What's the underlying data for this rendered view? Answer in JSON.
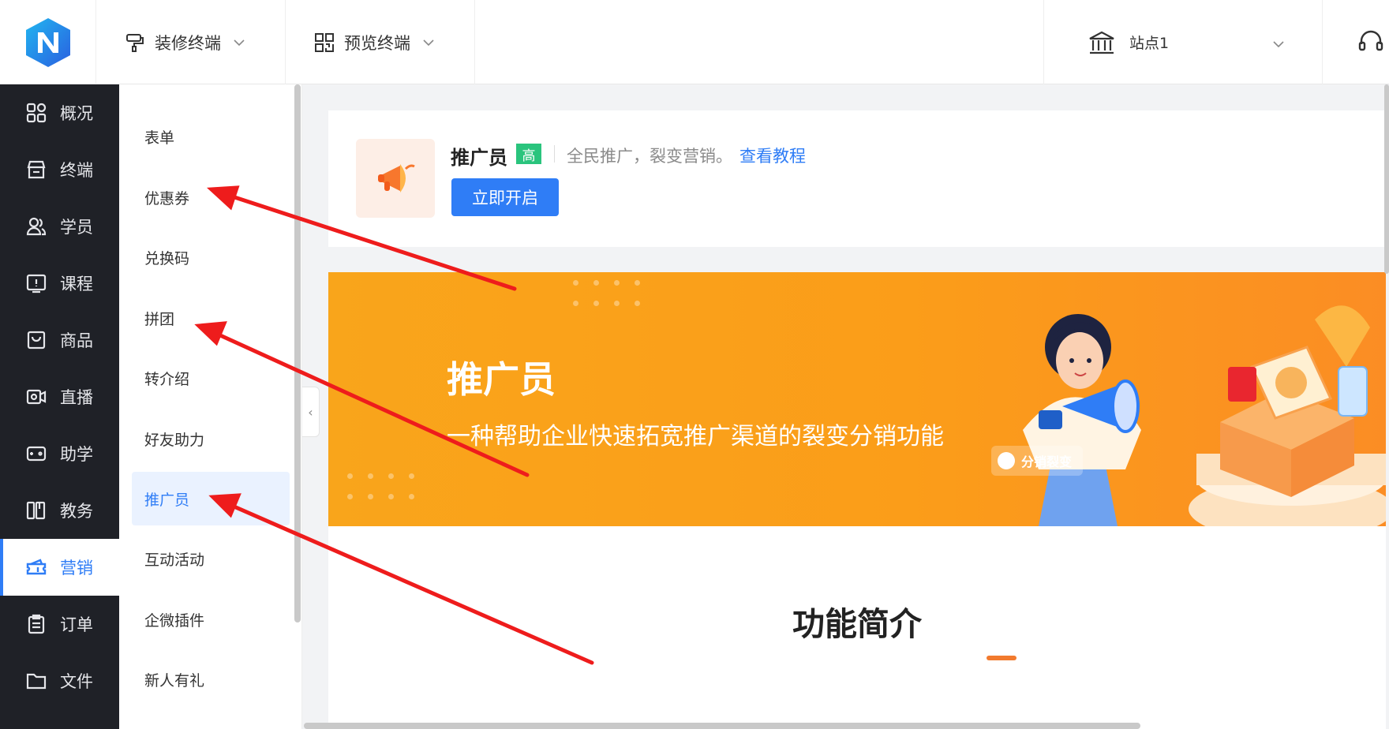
{
  "topbar": {
    "menus": [
      {
        "label": "装修终端",
        "icon": "paint-roller-icon"
      },
      {
        "label": "预览终端",
        "icon": "qr-code-icon"
      }
    ],
    "site": {
      "label": "站点1",
      "icon": "bank-icon"
    },
    "support_icon": "headset-icon"
  },
  "sidebar": {
    "items": [
      {
        "label": "概况",
        "icon": "grid-icon"
      },
      {
        "label": "终端",
        "icon": "store-icon"
      },
      {
        "label": "学员",
        "icon": "users-icon"
      },
      {
        "label": "课程",
        "icon": "course-icon"
      },
      {
        "label": "商品",
        "icon": "product-icon"
      },
      {
        "label": "直播",
        "icon": "live-icon"
      },
      {
        "label": "助学",
        "icon": "gamepad-icon"
      },
      {
        "label": "教务",
        "icon": "book-icon"
      },
      {
        "label": "营销",
        "icon": "ticket-icon",
        "active": true
      },
      {
        "label": "订单",
        "icon": "clipboard-icon"
      },
      {
        "label": "文件",
        "icon": "folder-icon"
      }
    ]
  },
  "submenu": {
    "items": [
      {
        "label": "表单"
      },
      {
        "label": "优惠券"
      },
      {
        "label": "兑换码"
      },
      {
        "label": "拼团"
      },
      {
        "label": "转介绍"
      },
      {
        "label": "好友助力"
      },
      {
        "label": "推广员",
        "active": true
      },
      {
        "label": "互动活动"
      },
      {
        "label": "企微插件"
      },
      {
        "label": "新人有礼"
      }
    ]
  },
  "card": {
    "title": "推广员",
    "badge": "高",
    "desc": "全民推广，裂变营销。",
    "link": "查看教程",
    "button": "立即开启",
    "icon": "megaphone-icon"
  },
  "banner": {
    "title": "推广员",
    "subtitle": "一种帮助企业快速拓宽推广渠道的裂变分销功能",
    "pill": "分销裂变",
    "colors": {
      "start": "#f9a51b",
      "end": "#fb8d24"
    }
  },
  "section": {
    "title": "功能简介"
  },
  "colors": {
    "accent": "#2f7df6",
    "sidebar_bg": "#1f2127",
    "badge": "#2ac47d",
    "annotation_arrow": "#ee1c1c"
  }
}
